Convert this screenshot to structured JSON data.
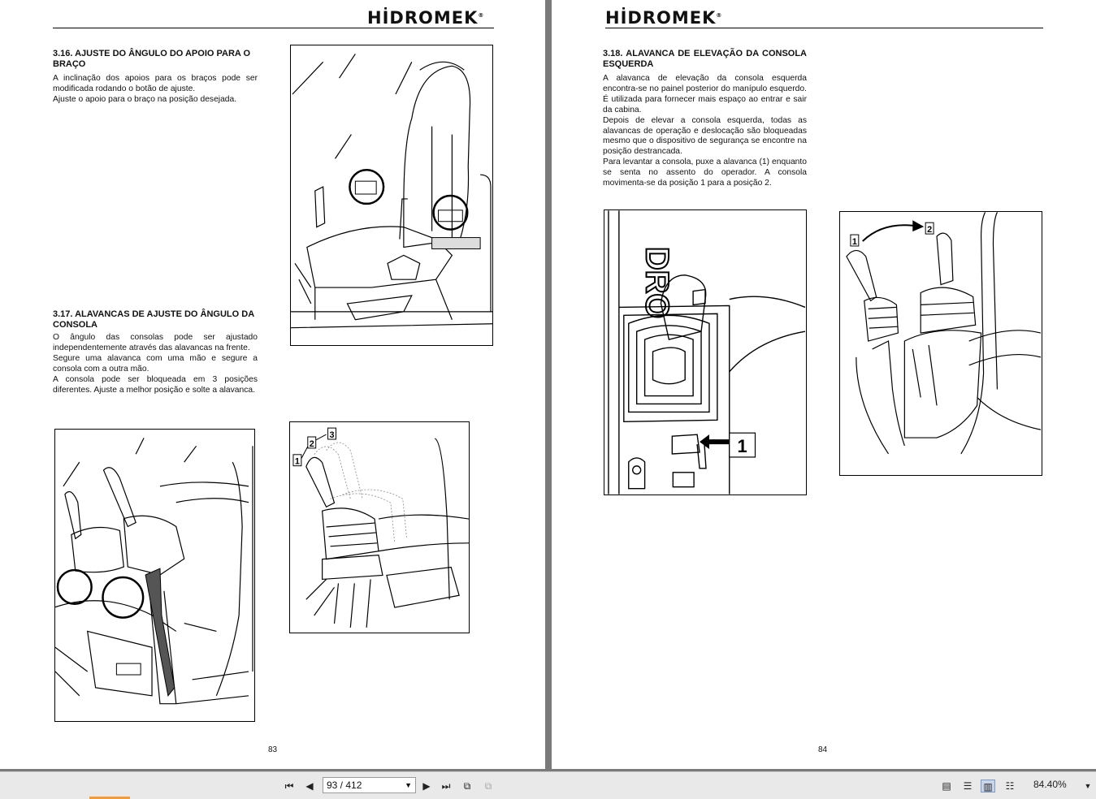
{
  "left_page": {
    "brand": "HİDROMEK",
    "section_316": {
      "title": "3.16. AJUSTE DO ÂNGULO DO APOIO PARA O BRAÇO",
      "lines": [
        "A inclinação dos apoios para os braços pode ser modificada rodando o botão de ajuste.",
        "Ajuste o apoio para o braço na posição desejada."
      ]
    },
    "section_317": {
      "title": "3.17. ALAVANCAS DE AJUSTE DO ÂNGULO DA CONSOLA",
      "lines": [
        "O ângulo das consolas pode ser ajustado independentemente através das alavancas na frente.",
        "Segure uma alavanca com uma mão e segure a consola com a outra mão.",
        "A consola pode ser bloqueada em 3 posições diferentes. Ajuste a melhor posição e solte a alavanca."
      ]
    },
    "figure_labels": [
      "1",
      "2",
      "3"
    ],
    "page_number": "83"
  },
  "right_page": {
    "brand": "HİDROMEK",
    "section_318": {
      "title": "3.18. ALAVANCA DE ELEVAÇÃO DA CONSOLA ESQUERDA",
      "lines": [
        "A alavanca de elevação da consola esquerda encontra-se no painel posterior do manípulo esquerdo. É utilizada para fornecer mais espaço ao entrar e sair da cabina.",
        "Depois de elevar a consola esquerda, todas as alavancas de operação e deslocação são bloqueadas mesmo que o dispositivo de segurança se encontre na posição destrancada.",
        "Para levantar a consola, puxe a alavanca (1) enquanto se senta no assento do operador. A consola movimenta-se da posição 1 para a posição 2."
      ]
    },
    "figure_left_label": "1",
    "figure_left_text": "DRO",
    "figure_right_labels": [
      "1",
      "2"
    ],
    "page_number": "84"
  },
  "toolbar": {
    "page_indicator": "93 / 412",
    "zoom": "84.40%"
  }
}
